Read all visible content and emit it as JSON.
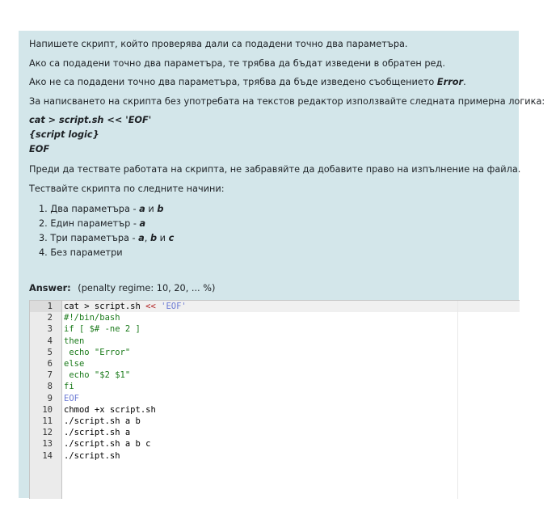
{
  "question": {
    "lines": [
      "Напишете скрипт, който проверява дали са подадени точно два параметъра.",
      "Ако са подадени точно два параметъра, те трябва да бъдат изведени в обратен ред.",
      "Ако не са подадени точно два параметъра, трябва да бъде изведено съобщението",
      "За написването на скрипта без употребата на текстов редактор използвайте следната примерна логика:"
    ],
    "error_word": "Error",
    "period": ".",
    "logic": [
      "cat > script.sh << 'EOF'",
      "{script logic}",
      "EOF"
    ],
    "before_test": "Преди да тествате работата на скрипта, не забравяйте да добавите право на изпълнение на файла.",
    "test_intro": "Тествайте скрипта по следните начини:",
    "options": [
      {
        "num": "1.",
        "text": "Два параметъра - ",
        "a": "a",
        "and": " и ",
        "b": "b"
      },
      {
        "num": "2.",
        "text": "Един параметър - ",
        "a": "a"
      },
      {
        "num": "3.",
        "text": "Три параметъра - ",
        "a": "a",
        "comma": ", ",
        "b": "b",
        "and": " и ",
        "c": "c"
      },
      {
        "num": "4.",
        "text": "Без параметри"
      }
    ]
  },
  "answer": {
    "label": "Answer:",
    "penalty": "(penalty regime: 10, 20, ... %)"
  },
  "editor": {
    "lines": [
      "cat > script.sh << 'EOF'",
      "#!/bin/bash",
      "if [ $# -ne 2 ]",
      "then",
      " echo \"Error\"",
      "else",
      " echo \"$2 $1\"",
      "fi",
      "EOF",
      "chmod +x script.sh",
      "./script.sh a b",
      "./script.sh a",
      "./script.sh a b c",
      "./script.sh"
    ]
  }
}
